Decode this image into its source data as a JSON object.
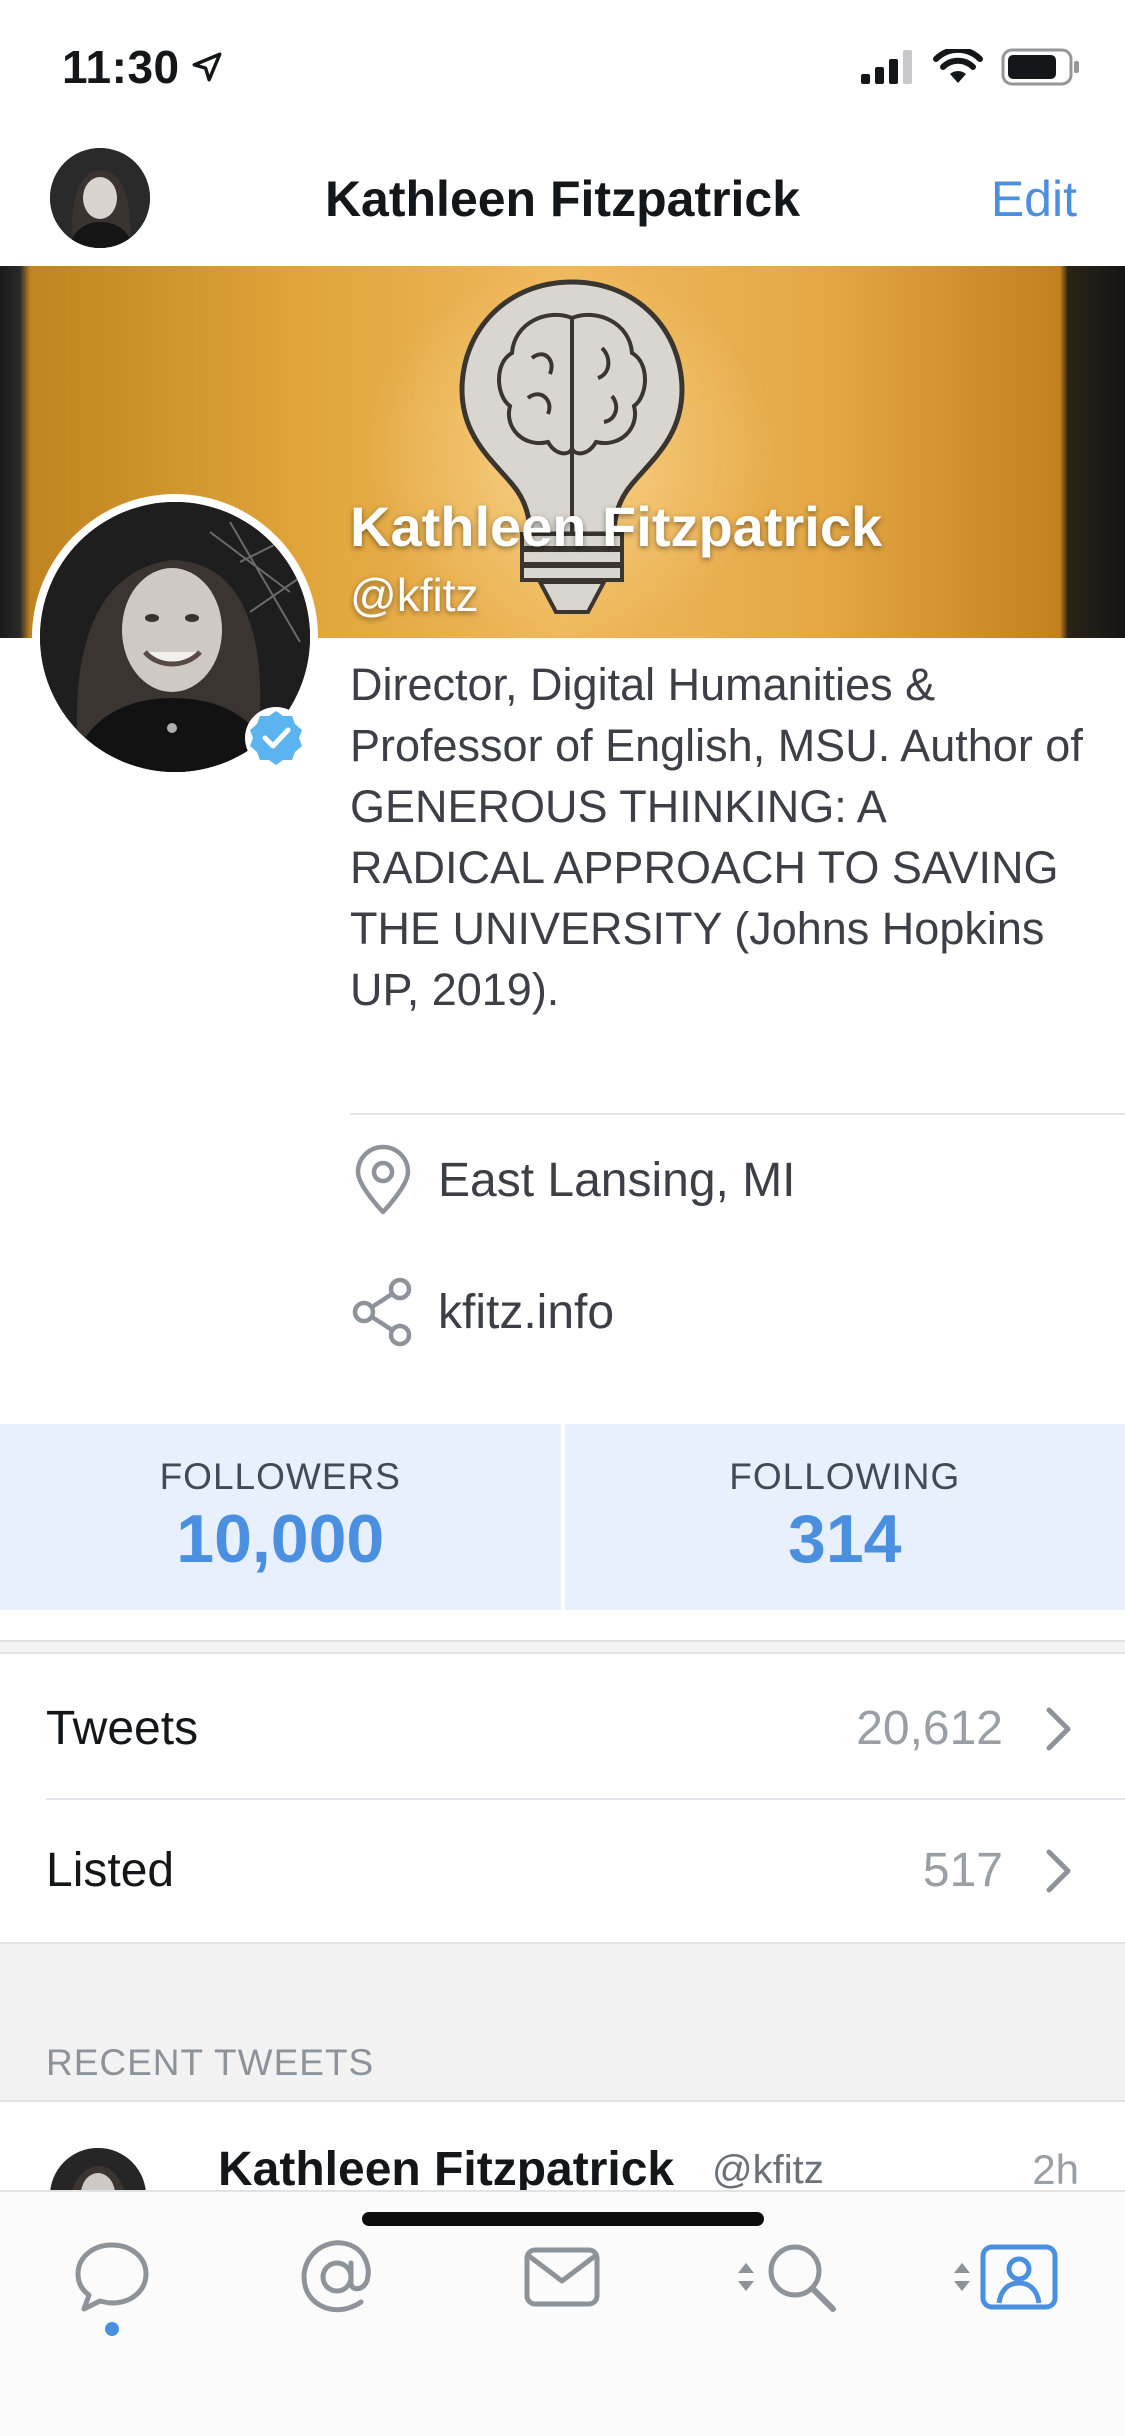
{
  "status_bar": {
    "time": "11:30",
    "icons": [
      "location-arrow-icon",
      "signal-icon",
      "wifi-icon",
      "battery-icon"
    ]
  },
  "nav": {
    "title": "Kathleen Fitzpatrick",
    "edit_label": "Edit"
  },
  "profile": {
    "name": "Kathleen Fitzpatrick",
    "handle": "@kfitz",
    "verified": true,
    "bio": "Director, Digital Humanities & Professor of English, MSU. Author of GENEROUS THINKING: A RADICAL APPROACH TO SAVING THE UNIVERSITY (Johns Hopkins UP, 2019).",
    "location": "East Lansing, MI",
    "website": "kfitz.info"
  },
  "stats": {
    "followers_label": "FOLLOWERS",
    "followers_value": "10,000",
    "following_label": "FOLLOWING",
    "following_value": "314"
  },
  "list": {
    "tweets_label": "Tweets",
    "tweets_count": "20,612",
    "listed_label": "Listed",
    "listed_count": "517"
  },
  "recent": {
    "section_title": "RECENT TWEETS",
    "tweet_name": "Kathleen Fitzpatrick",
    "tweet_handle": "@kfitz",
    "tweet_time": "2h"
  },
  "tabs": [
    {
      "name": "timeline",
      "icon": "speech-bubble-icon",
      "active": true
    },
    {
      "name": "mentions",
      "icon": "at-sign-icon",
      "active": false
    },
    {
      "name": "messages",
      "icon": "envelope-icon",
      "active": false
    },
    {
      "name": "search",
      "icon": "search-icon",
      "active": false
    },
    {
      "name": "profile",
      "icon": "profile-icon",
      "active": false
    }
  ],
  "colors": {
    "accent": "#4a8fe0",
    "stats_background": "#e7f0fc",
    "verified": "#5bb4f0"
  }
}
